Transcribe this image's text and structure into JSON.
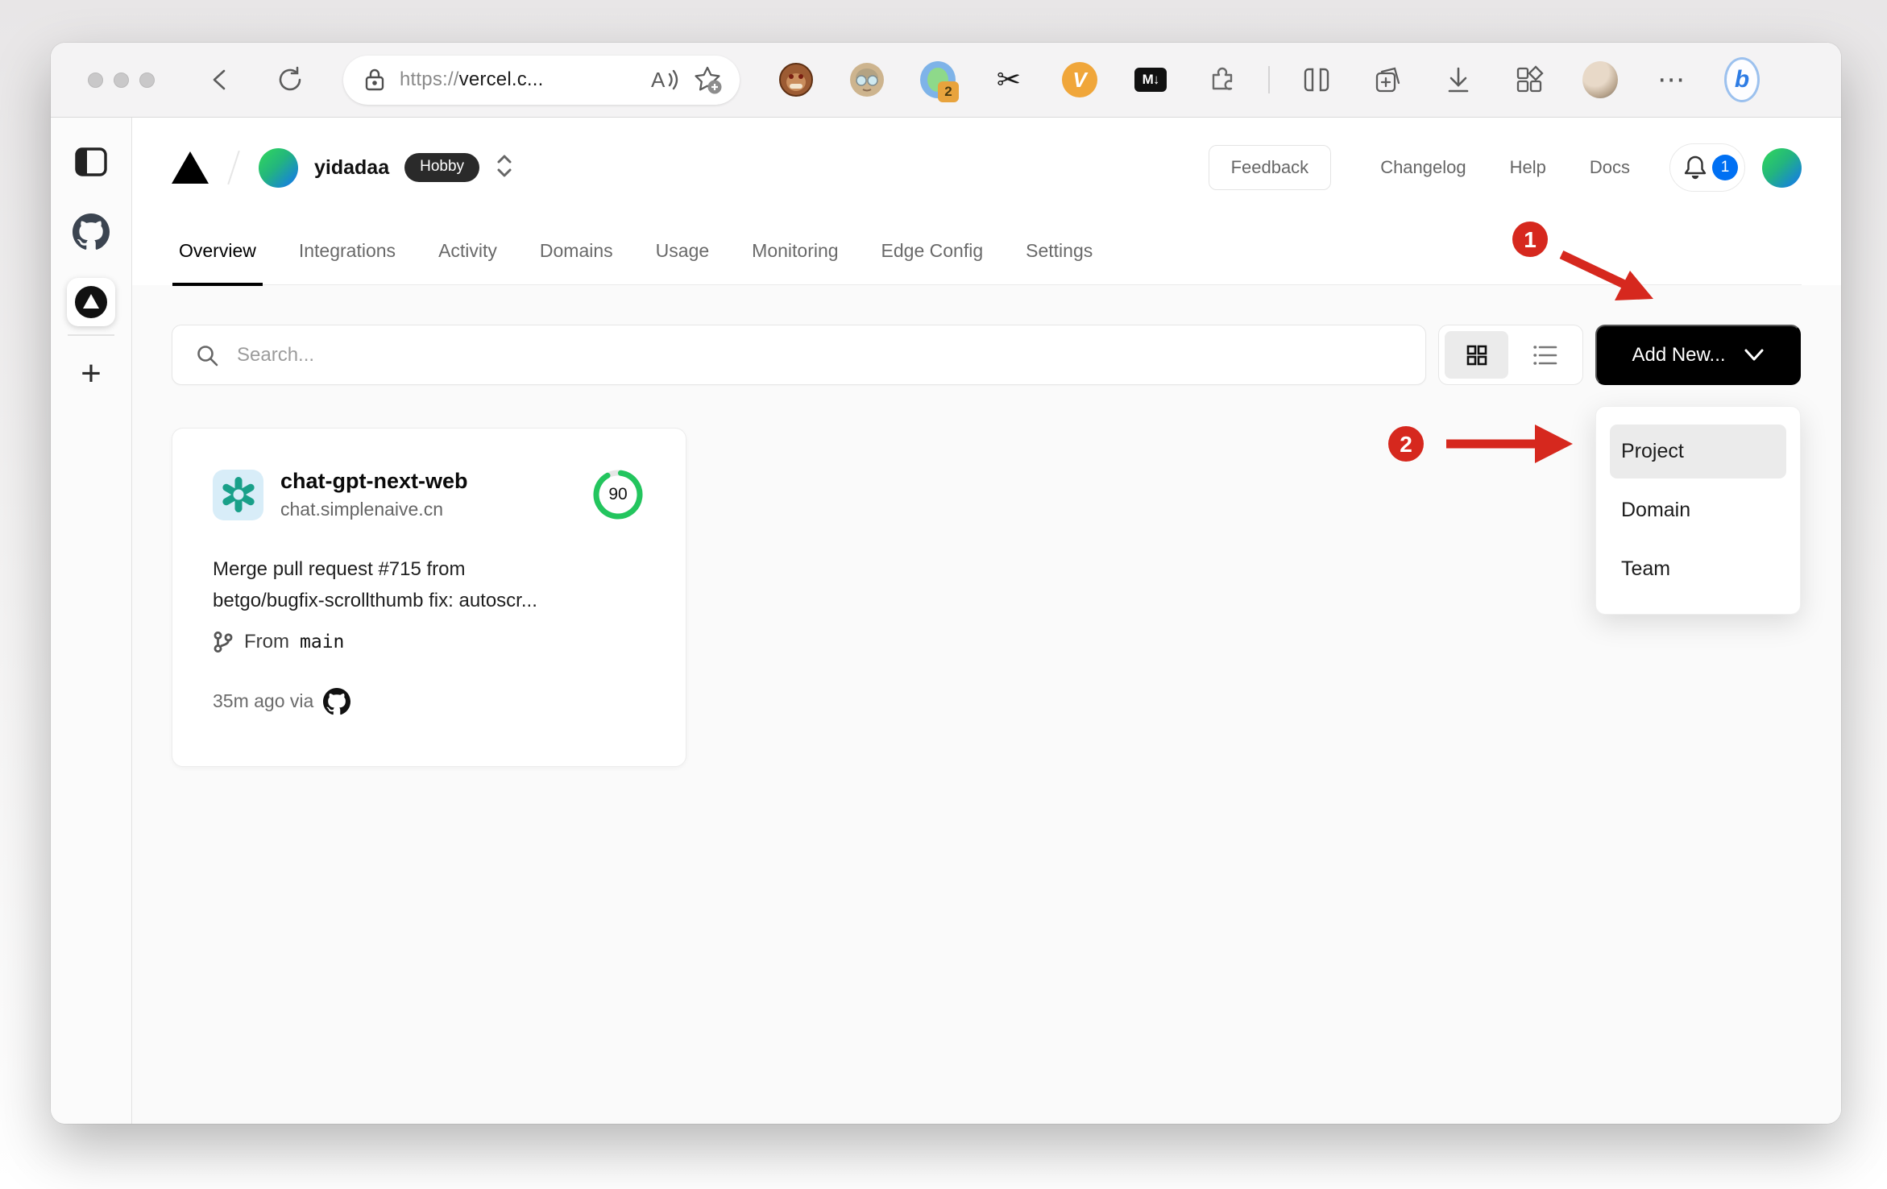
{
  "browser": {
    "url_scheme": "https://",
    "url_host": "vercel.c...",
    "profile_tab_badge": "2",
    "markdown_badge": "M↓",
    "glyphs": {
      "scissors": "✂",
      "v_letter": "V",
      "dots": "⋯",
      "plus": "+",
      "bing_letter": "b",
      "read_aloud": "A"
    }
  },
  "header": {
    "team_name": "yidadaa",
    "plan_badge": "Hobby",
    "feedback_label": "Feedback",
    "links": [
      {
        "label": "Changelog"
      },
      {
        "label": "Help"
      },
      {
        "label": "Docs"
      }
    ],
    "notification_count": "1"
  },
  "tabs": [
    {
      "label": "Overview"
    },
    {
      "label": "Integrations"
    },
    {
      "label": "Activity"
    },
    {
      "label": "Domains"
    },
    {
      "label": "Usage"
    },
    {
      "label": "Monitoring"
    },
    {
      "label": "Edge Config"
    },
    {
      "label": "Settings"
    }
  ],
  "toolbar": {
    "search_placeholder": "Search...",
    "add_new_label": "Add New..."
  },
  "dropdown": {
    "items": [
      {
        "label": "Project"
      },
      {
        "label": "Domain"
      },
      {
        "label": "Team"
      }
    ]
  },
  "project_card": {
    "name": "chat-gpt-next-web",
    "domain": "chat.simplenaive.cn",
    "score": "90",
    "commit_line1": "Merge pull request #715 from",
    "commit_line2": "betgo/bugfix-scrollthumb fix: autoscr...",
    "from_label": "From",
    "branch": "main",
    "deployed": "35m ago via"
  },
  "annotations": {
    "step1": "1",
    "step2": "2"
  },
  "colors": {
    "annotation_red": "#d6281e",
    "score_green": "#23c55e",
    "notification_blue": "#0070f3"
  }
}
